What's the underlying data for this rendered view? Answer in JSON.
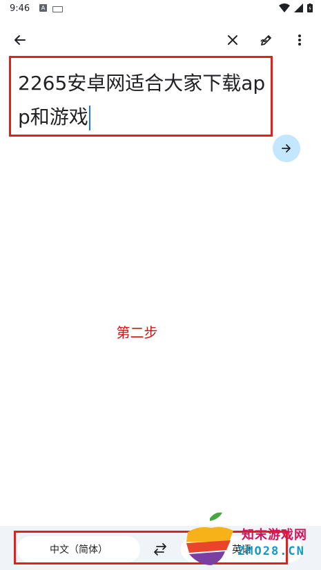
{
  "status_bar": {
    "time": "9:46",
    "icons": [
      "android-notification-icon",
      "keyboard-icon",
      "wifi-icon",
      "signal-icon",
      "battery-icon"
    ]
  },
  "top_bar": {
    "back_icon": "arrow-left-icon",
    "clear_icon": "close-icon",
    "handwriting_icon": "pen-icon",
    "more_icon": "more-vert-icon"
  },
  "input": {
    "text": "2265安卓网适合大家下载app和游戏"
  },
  "annotation": {
    "step_label": "第二步"
  },
  "languages": {
    "source": "中文（简体）",
    "target": "英语",
    "swap_icon": "swap-arrows-icon"
  },
  "watermark": {
    "line1": "知末游戏网",
    "line2": "ZMO28.CN"
  },
  "colors": {
    "annotation_red": "#e0201a",
    "accent_blue": "#1a73e8",
    "go_button": "#c2e7ff",
    "bottom_bg": "#f0f4f9"
  }
}
